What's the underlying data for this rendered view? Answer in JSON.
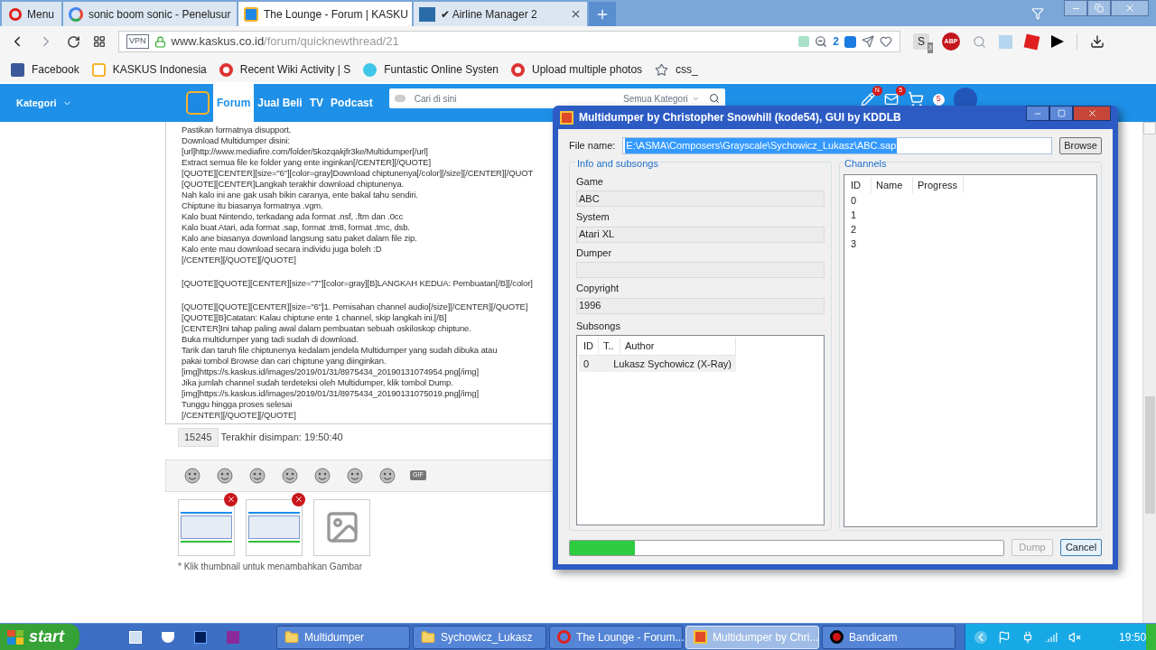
{
  "browser": {
    "menu": "Menu",
    "tabs": [
      {
        "title": "sonic boom sonic - Penelusur",
        "kind": "google",
        "selected": false
      },
      {
        "title": "The Lounge - Forum | KASKU",
        "kind": "kaskus",
        "selected": true
      },
      {
        "title": "✔ Airline Manager 2",
        "kind": "airline",
        "selected": false
      }
    ],
    "address": {
      "vpn": "VPN",
      "domain": "www.kaskus.co.id",
      "path": "/forum/quicknewthread/21",
      "blocked_count": "2"
    },
    "extensions": {
      "s_badge": "S",
      "s_count": "3",
      "adblock": "ABP"
    },
    "bookmarks": [
      {
        "label": "Facebook",
        "kind": "facebook"
      },
      {
        "label": "KASKUS Indonesia",
        "kind": "kaskus"
      },
      {
        "label": "Recent Wiki Activity | S",
        "kind": "wiki"
      },
      {
        "label": "Funtastic Online Systen",
        "kind": "cloud"
      },
      {
        "label": "Upload multiple photos",
        "kind": "wiki"
      },
      {
        "label": "css_",
        "kind": "star"
      }
    ]
  },
  "site_header": {
    "category": "Kategori",
    "nav": [
      {
        "label": "Forum",
        "selected": true
      },
      {
        "label": "Jual Beli",
        "selected": false
      },
      {
        "label": "TV",
        "selected": false
      },
      {
        "label": "Podcast",
        "selected": false
      }
    ],
    "search_placeholder": "Cari di sini",
    "search_category": "Semua Kategori",
    "notification_badges": [
      "N",
      "5"
    ],
    "user_badge": "5"
  },
  "editor": {
    "paragraphs": [
      [
        "Pastikan formatnya disupport.",
        "Download Multidumper disini:",
        "[url]http://www.mediafire.com/folder/5kozqakjfr3ke/Multidumper[/url]",
        "Extract semua file ke folder yang ente inginkan[/CENTER][/QUOTE]",
        "[QUOTE][CENTER][size=\"6\"][color=gray]Download chiptunenya[/color][/size][/CENTER][/QUOT",
        "[QUOTE][CENTER]Langkah terakhir download chiptunenya.",
        "Nah kalo ini ane gak usah bikin caranya, ente bakal tahu sendiri.",
        "Chiptune itu biasanya formatnya .vgm.",
        "Kalo buat Nintendo, terkadang ada format .nsf, .ftm dan .0cc",
        "Kalo buat Atari, ada format .sap, format .tm8, format .tmc, dsb.",
        "Kalo ane biasanya download langsung satu paket dalam file zip.",
        "Kalo ente mau download secara individu juga boleh :D",
        "[/CENTER][/QUOTE][/QUOTE]"
      ],
      [
        "[QUOTE][QUOTE][CENTER][size=\"7\"][color=gray][B]LANGKAH KEDUA: Pembuatan[/B][/color]"
      ],
      [
        "[QUOTE][QUOTE][CENTER][size=\"6\"]1. Pemisahan channel audio[/size][/CENTER][/QUOTE]",
        "[QUOTE][B]Catatan: Kalau chiptune ente 1 channel, skip langkah ini.[/B]",
        "[CENTER]Ini tahap paling awal dalam pembuatan sebuah oskiloskop chiptune.",
        "Buka multidumper yang tadi sudah di download.",
        "Tarik dan taruh file chiptunenya kedalam jendela Multidumper yang sudah dibuka atau",
        "pakai tombol Browse dan cari chiptune yang diinginkan.",
        "[img]https://s.kaskus.id/images/2019/01/31/8975434_20190131074954.png[/img]",
        "Jika jumlah channel sudah terdeteksi oleh Multidumper, klik tombol Dump.",
        "[img]https://s.kaskus.id/images/2019/01/31/8975434_20190131075019.png[/img]",
        "Tunggu hingga proses selesai",
        "[/CENTER][/QUOTE][/QUOTE]"
      ]
    ],
    "char_count": "15245",
    "saved": "Terakhir disimpan: 19:50:40",
    "gif_label": "GIF",
    "thumbnails": [
      {
        "kind": "screenshot"
      },
      {
        "kind": "screenshot"
      },
      {
        "kind": "add"
      }
    ],
    "hint": "* Klik thumbnail untuk menambahkan Gambar"
  },
  "dialog": {
    "title": "Multidumper by Christopher Snowhill (kode54), GUI by KDDLB",
    "file_label": "File name:",
    "file_value": "E:\\ASMA\\Composers\\Grayscale\\Sychowicz_Lukasz\\ABC.sap",
    "file_value_selected": true,
    "browse": "Browse",
    "info_title": "Info and subsongs",
    "fields": [
      {
        "label": "Game",
        "value": "ABC"
      },
      {
        "label": "System",
        "value": "Atari XL"
      },
      {
        "label": "Dumper"
      },
      {
        "label": "Copyright",
        "value": "1996"
      }
    ],
    "subsongs_label": "Subsongs",
    "subsong_columns": [
      "ID",
      "T..",
      "Author"
    ],
    "subsongs": [
      {
        "id": "0",
        "author": "Lukasz Sychowicz (X-Ray)"
      }
    ],
    "channels_title": "Channels",
    "channel_columns": [
      "ID",
      "Name",
      "Progress"
    ],
    "channels": [
      "0",
      "1",
      "2",
      "3"
    ],
    "progress": {
      "level": 0.15
    },
    "dump": {
      "label": "Dump",
      "disabled": true
    },
    "cancel": "Cancel"
  },
  "taskbar": {
    "start": "start",
    "tasks": [
      {
        "label": "Multidumper",
        "kind": "folder",
        "selected": false
      },
      {
        "label": "Sychowicz_Lukasz",
        "kind": "folder",
        "selected": false
      },
      {
        "label": "The Lounge - Forum...",
        "kind": "opera",
        "selected": false
      },
      {
        "label": "Multidumper by Chri...",
        "kind": "app",
        "selected": true
      },
      {
        "label": "Bandicam",
        "kind": "record",
        "selected": false
      }
    ],
    "clock": "19:50"
  }
}
